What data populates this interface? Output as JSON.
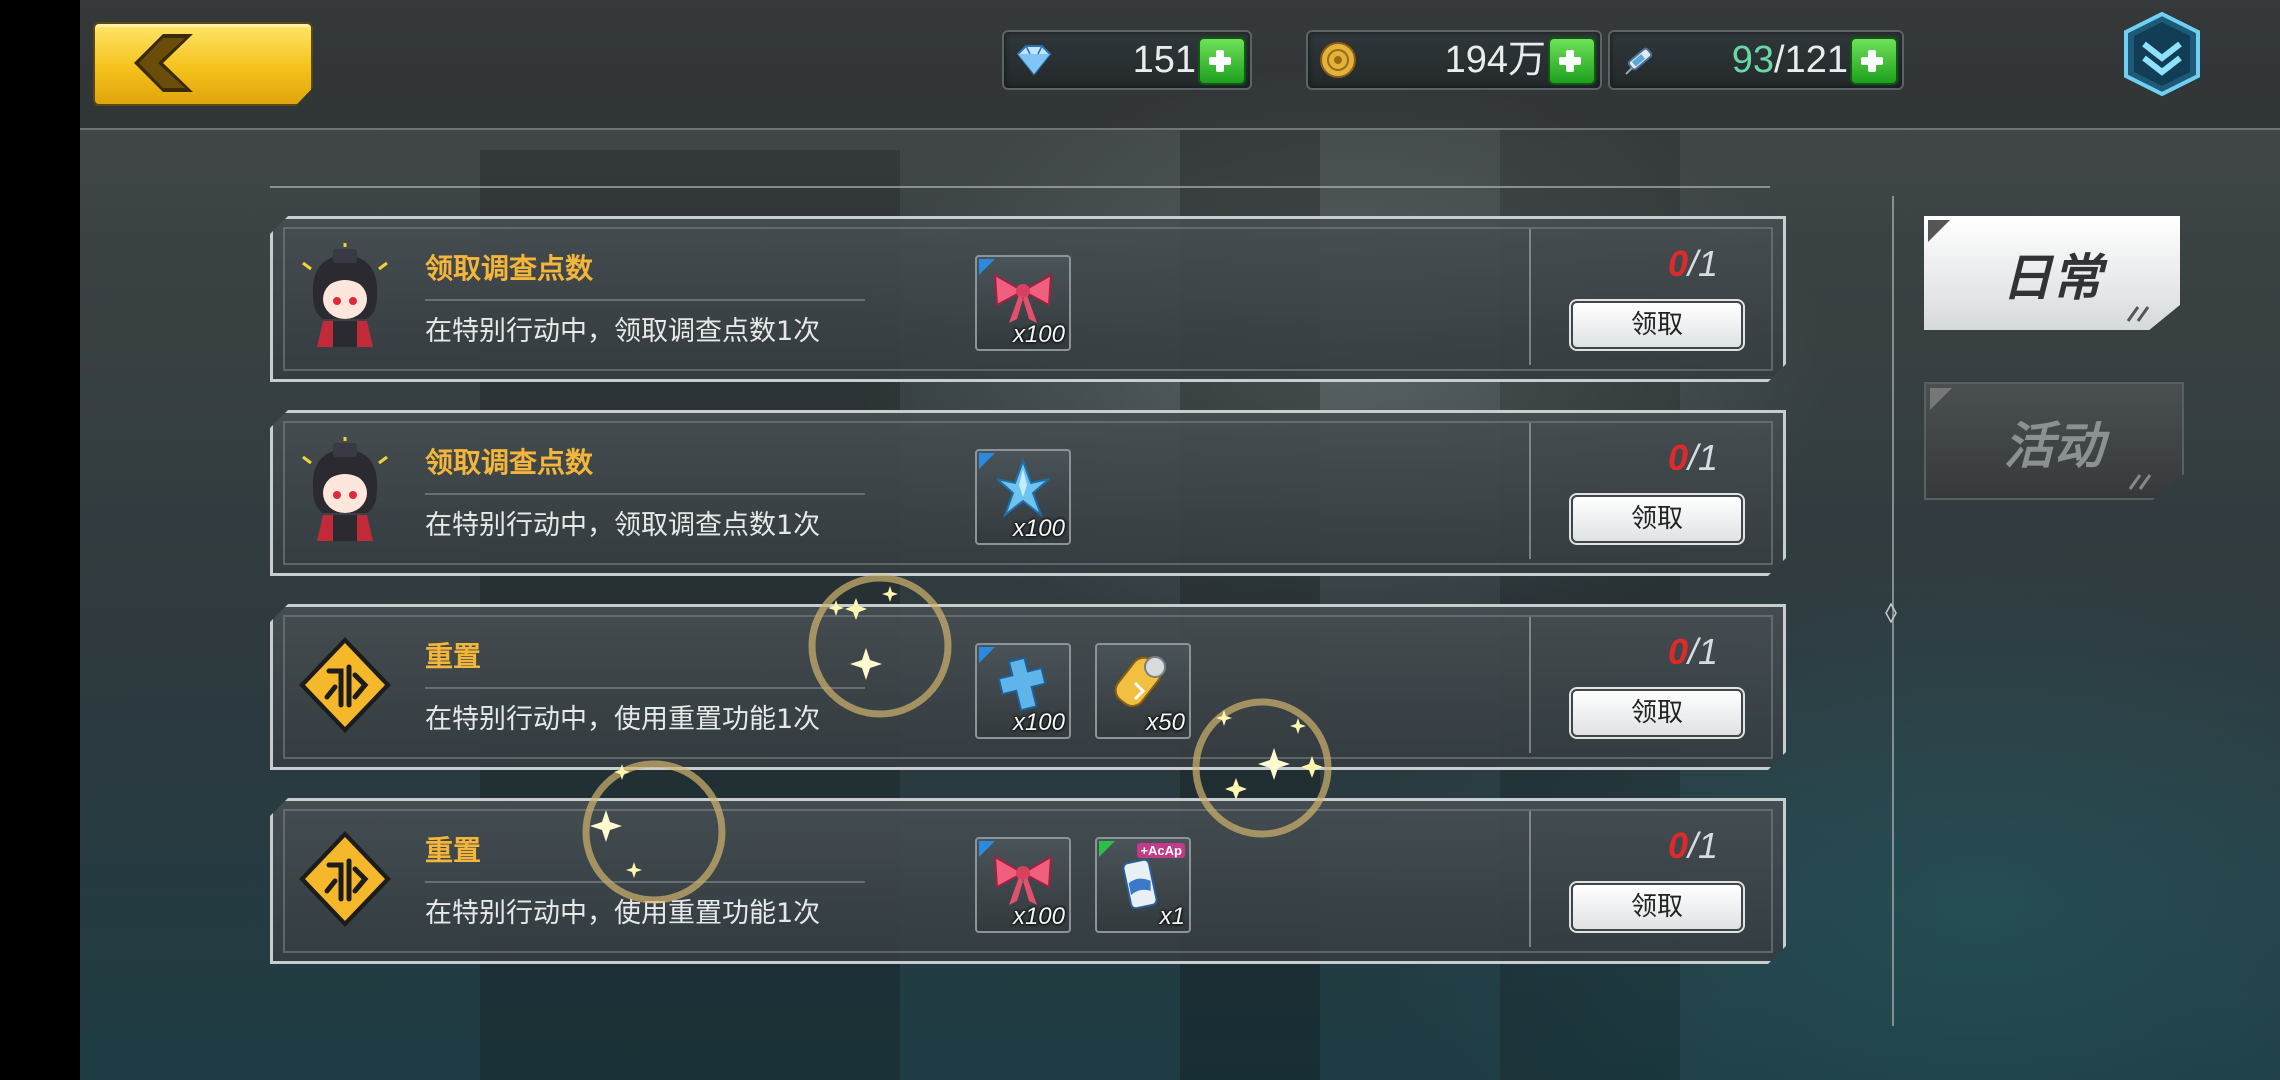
{
  "resources": {
    "gems": {
      "icon": "diamond-icon",
      "value": "151"
    },
    "coins": {
      "icon": "coin-icon",
      "value": "194万"
    },
    "stamina": {
      "icon": "syringe-icon",
      "current": "93",
      "separator": "/",
      "max": "121"
    }
  },
  "tabs": {
    "daily": "日常",
    "event": "活动",
    "selected": "daily"
  },
  "tasks": [
    {
      "icon": "chibi-girl-avatar",
      "title": "领取调查点数",
      "desc": "在特别行动中，领取调查点数1次",
      "rewards": [
        {
          "icon": "pink-bow-icon",
          "qty": "x100",
          "corner": "blue"
        }
      ],
      "progress": {
        "current": "0",
        "sep": "/",
        "total": "1"
      },
      "claim": "领取"
    },
    {
      "icon": "chibi-girl-avatar",
      "title": "领取调查点数",
      "desc": "在特别行动中，领取调查点数1次",
      "rewards": [
        {
          "icon": "blue-crystal-icon",
          "qty": "x100",
          "corner": "blue"
        }
      ],
      "progress": {
        "current": "0",
        "sep": "/",
        "total": "1"
      },
      "claim": "领取"
    },
    {
      "icon": "reset-sign-icon",
      "title": "重置",
      "desc": "在特别行动中，使用重置功能1次",
      "rewards": [
        {
          "icon": "blue-cross-icon",
          "qty": "x100",
          "corner": "blue"
        },
        {
          "icon": "gold-ticket-icon",
          "qty": "x50",
          "corner": "none"
        }
      ],
      "progress": {
        "current": "0",
        "sep": "/",
        "total": "1"
      },
      "claim": "领取"
    },
    {
      "icon": "reset-sign-icon",
      "title": "重置",
      "desc": "在特别行动中，使用重置功能1次",
      "rewards": [
        {
          "icon": "pink-bow-icon",
          "qty": "x100",
          "corner": "blue"
        },
        {
          "icon": "drink-can-icon",
          "qty": "x1",
          "corner": "green",
          "badge": "+AcAp"
        }
      ],
      "progress": {
        "current": "0",
        "sep": "/",
        "total": "1"
      },
      "claim": "领取"
    }
  ],
  "colors": {
    "title": "#f3b53a",
    "progress_current": "#e02a2a",
    "stamina_current": "#69d8a5",
    "back_button": "#f5c21c"
  }
}
